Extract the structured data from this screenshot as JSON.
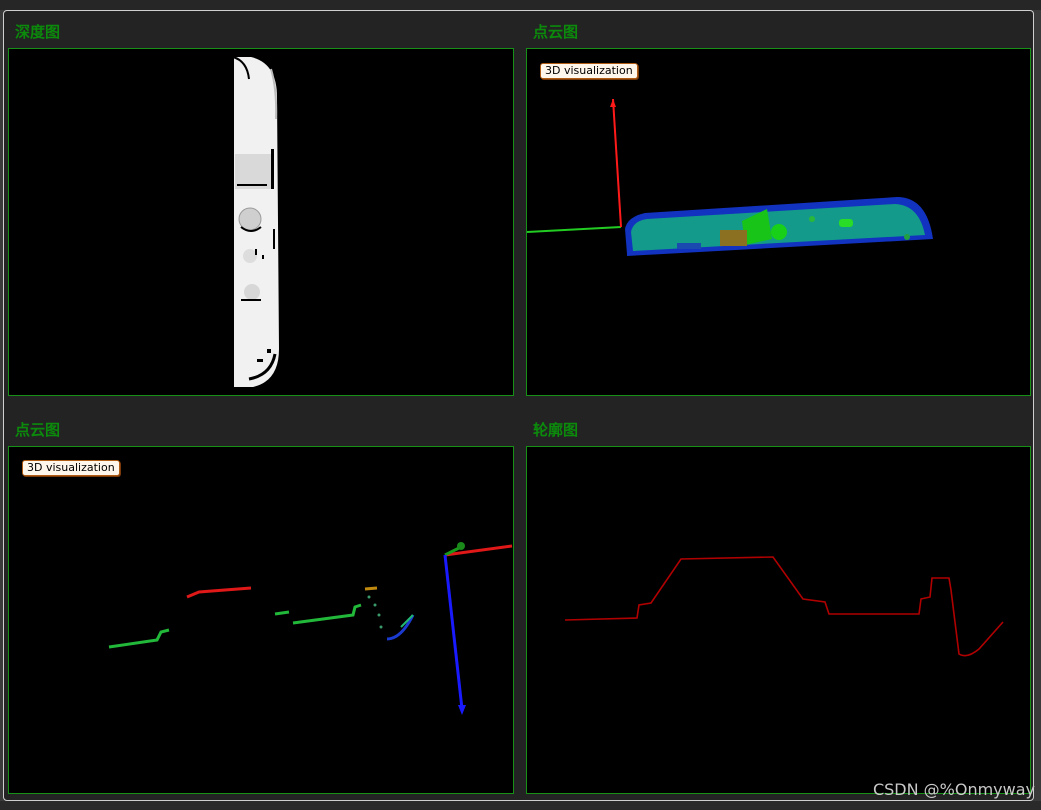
{
  "panels": {
    "depth": {
      "title": "深度图"
    },
    "cloud_top": {
      "title": "点云图",
      "overlay_label": "3D visualization"
    },
    "cloud_bottom": {
      "title": "点云图",
      "overlay_label": "3D visualization"
    },
    "contour": {
      "title": "轮廓图"
    }
  },
  "colors": {
    "panel_border": "#179017",
    "title_text": "#0b8a0b",
    "axis_x": "#ff1a1a",
    "axis_y": "#22cc22",
    "axis_z": "#1a1aff",
    "contour_line": "#b00000"
  },
  "watermark": "CSDN @%Onmyway"
}
